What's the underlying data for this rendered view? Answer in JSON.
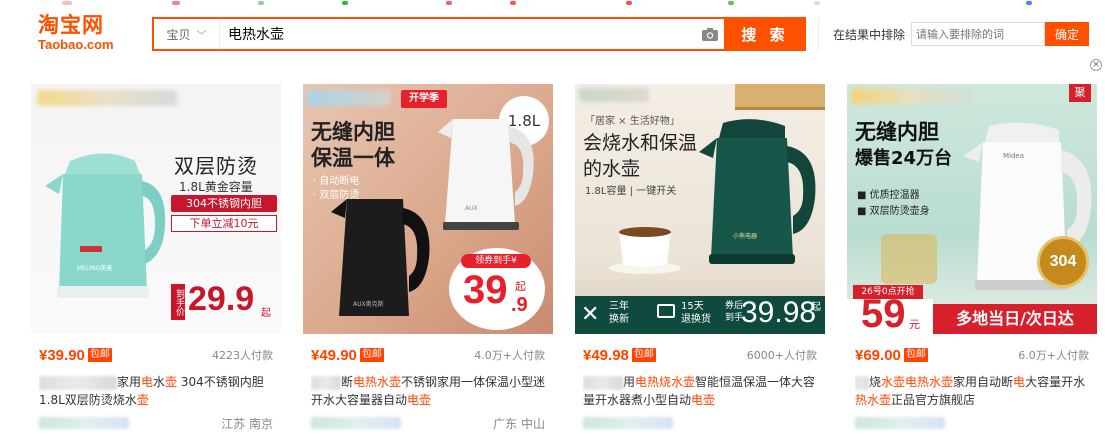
{
  "logo": {
    "cn": "淘宝网",
    "en": "Taobao.com"
  },
  "search": {
    "category": "宝贝",
    "value": "电热水壶",
    "button": "搜 索"
  },
  "exclude": {
    "label": "在结果中排除",
    "placeholder": "请输入要排除的词",
    "button": "确定"
  },
  "close": "×",
  "products": [
    {
      "price": "¥39.90",
      "badge": "包邮",
      "sold": "4223人付款",
      "title_parts": [
        [
          "",
          "blur"
        ],
        [
          "家用",
          ""
        ],
        [
          "电",
          "hl"
        ],
        [
          "水",
          ""
        ],
        [
          "壶",
          "hl"
        ],
        [
          " 304不锈钢内胆1.8L双层防烫烧水",
          ""
        ],
        [
          "壶",
          "hl"
        ]
      ],
      "location": "江苏 南京",
      "img": {
        "headline": "双层防烫",
        "sub": "1.8L黄金容量",
        "tag1": "304不锈钢内胆",
        "tag2": "下单立减10元",
        "pre": "到手价",
        "amount": "29.9",
        "unit": "起",
        "brand": "MELING美菱"
      }
    },
    {
      "price": "¥49.90",
      "badge": "包邮",
      "sold": "4.0万+人付款",
      "title_parts": [
        [
          "",
          "blur"
        ],
        [
          "断",
          ""
        ],
        [
          "电热水壶",
          "hl"
        ],
        [
          "不锈钢家用一体保温小型迷开水大容量器自动",
          ""
        ],
        [
          "电壶",
          "hl"
        ]
      ],
      "location": "广东 中山",
      "img": {
        "ribbon": "开学季",
        "headline1": "无缝内胆",
        "headline2": "保温一体",
        "cap": "1.8L",
        "f1": "· 自动断电",
        "f2": "· 双层防烫",
        "pre": "领券到手¥",
        "amount": "39",
        "dec": ".9",
        "unit": "起",
        "brand": "AUX奥克斯"
      }
    },
    {
      "price": "¥49.98",
      "badge": "包邮",
      "sold": "6000+人付款",
      "title_parts": [
        [
          "",
          "blur"
        ],
        [
          "用",
          ""
        ],
        [
          "电热烧水壶",
          "hl"
        ],
        [
          "智能恒温保温一体大容量开水器煮小型自动",
          ""
        ],
        [
          "电壶",
          "hl"
        ]
      ],
      "location": "",
      "img": {
        "tagline": "「居家 × 生活好物」",
        "headline1": "会烧水和保温",
        "headline2": "的水壶",
        "sub": "1.8L容量 | 一键开关",
        "s1a": "三年",
        "s1b": "换新",
        "s2a": "15天",
        "s2b": "退换货",
        "pre1": "券后",
        "pre2": "到手",
        "amount": "39.98",
        "unit": "起",
        "brand": "小熊电器"
      }
    },
    {
      "price": "¥69.00",
      "badge": "包邮",
      "sold": "6.0万+人付款",
      "title_parts": [
        [
          "",
          "blur"
        ],
        [
          "烧",
          ""
        ],
        [
          "水壶电热水壶",
          "hl"
        ],
        [
          "家用自动断",
          ""
        ],
        [
          "电",
          "hl"
        ],
        [
          "大容量开水",
          ""
        ],
        [
          "热水壶",
          "hl"
        ],
        [
          "正品官方旗舰店",
          ""
        ]
      ],
      "location": "",
      "img": {
        "corner": "聚",
        "headline1": "无缝内胆",
        "headline2": "爆售24万台",
        "f1": "■ 优质控温器",
        "f2": "■ 双层防烫壶身",
        "date": "26号0点开抢",
        "amount": "59",
        "unit": "元",
        "banner": "多地当日/次日达",
        "seal": "304",
        "brand": "Midea"
      }
    }
  ],
  "colors": {
    "accent": "#ff5000",
    "price": "#ff4400"
  }
}
